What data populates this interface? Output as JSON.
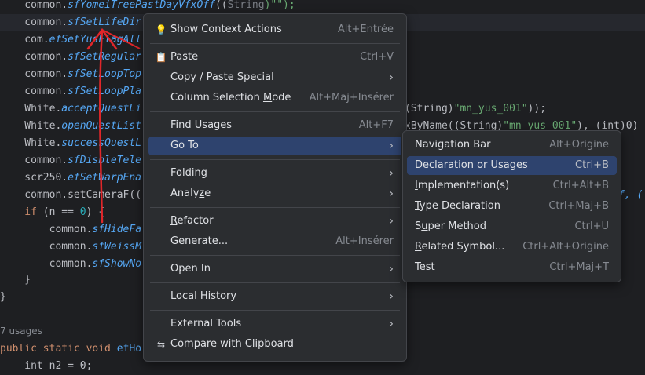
{
  "code": {
    "line0": {
      "pre": "    common.",
      "call": "sfYomeiTreePastDayVfxOff",
      "mid": "((",
      "kw": "String",
      "end": ")\"\");"
    },
    "line1": {
      "pre": "    common.",
      "call": "sfSetLifeDir"
    },
    "line2": {
      "pre": "    com.",
      "call": "efSetYusFlagAll"
    },
    "line3": {
      "pre": "    common.",
      "call": "sfSetRegular"
    },
    "line4": {
      "pre": "    common.",
      "call": "sfSetLoopTop"
    },
    "line5": {
      "pre": "    common.",
      "call": "sfSetLoopPla"
    },
    "line6": {
      "pre": "    White.",
      "call": "acceptQuestLi",
      "tail1": "(String)",
      "tail2": "\"mn_yus_001\"",
      "tail3": "));"
    },
    "line7": {
      "pre": "    White.",
      "call": "openQuestList",
      "tail1": "xByName((String)",
      "tail2": "\"mn_yus_001\"",
      "tail3": "), (int)0)"
    },
    "line8": {
      "pre": "    White.",
      "call": "successQuestL"
    },
    "line9": {
      "pre": "    common.",
      "call": "sfDisbleTele"
    },
    "line10": {
      "pre": "    scr250.",
      "call": "efSetWarpEna"
    },
    "line11": {
      "pre": "    common.",
      "call": "setCameraF",
      "open": "((",
      "tail": "f, ("
    },
    "line12": {
      "kw": "    if",
      "mid": " (n == ",
      "num": "0",
      "end": ") {"
    },
    "line13": {
      "pre": "        common.",
      "call": "sfHideFa"
    },
    "line14": {
      "pre": "        common.",
      "call": "sfWeissM"
    },
    "line15": {
      "pre": "        common.",
      "call": "sfShowNo"
    },
    "line16": {
      "text": "    }"
    },
    "line17": {
      "text": "}"
    },
    "usages": "7 usages",
    "line18": {
      "kw": "public static void ",
      "call": "efHo"
    },
    "line19": {
      "text": "    int n2 = 0;"
    }
  },
  "context_menu": {
    "show_context_actions": {
      "label": "Show Context Actions",
      "shortcut": "Alt+Entrée",
      "icon": "lightbulb-icon"
    },
    "paste": {
      "label": "Paste",
      "shortcut": "Ctrl+V",
      "icon": "clipboard-icon"
    },
    "copy_paste_special": {
      "label": "Copy / Paste Special"
    },
    "column_selection_mode": {
      "label_pre": "Column Selection ",
      "label_u": "M",
      "label_post": "ode",
      "shortcut": "Alt+Maj+Insérer"
    },
    "find_usages": {
      "label_pre": "Find ",
      "label_u": "U",
      "label_post": "sages",
      "shortcut": "Alt+F7"
    },
    "go_to": {
      "label": "Go To"
    },
    "folding": {
      "label": "Folding"
    },
    "analyze": {
      "label_pre": "Analy",
      "label_u": "z",
      "label_post": "e"
    },
    "refactor": {
      "label_pre": "",
      "label_u": "R",
      "label_post": "efactor"
    },
    "generate": {
      "label": "Generate...",
      "shortcut": "Alt+Insérer"
    },
    "open_in": {
      "label": "Open In"
    },
    "local_history": {
      "label_pre": "Local ",
      "label_u": "H",
      "label_post": "istory"
    },
    "external_tools": {
      "label": "External Tools"
    },
    "compare_clipboard": {
      "label_pre": "Compare with Clip",
      "label_u": "b",
      "label_post": "oard",
      "icon": "compare-icon"
    }
  },
  "goto_submenu": {
    "navigation_bar": {
      "label": "Navigation Bar",
      "shortcut": "Alt+Origine"
    },
    "declaration": {
      "label_pre": "",
      "label_u": "D",
      "label_post": "eclaration or Usages",
      "shortcut": "Ctrl+B"
    },
    "implementation": {
      "label_pre": "",
      "label_u": "I",
      "label_post": "mplementation(s)",
      "shortcut": "Ctrl+Alt+B"
    },
    "type_declaration": {
      "label_pre": "",
      "label_u": "T",
      "label_post": "ype Declaration",
      "shortcut": "Ctrl+Maj+B"
    },
    "super_method": {
      "label_pre": "S",
      "label_u": "u",
      "label_post": "per Method",
      "shortcut": "Ctrl+U"
    },
    "related_symbol": {
      "label_pre": "",
      "label_u": "R",
      "label_post": "elated Symbol...",
      "shortcut": "Ctrl+Alt+Origine"
    },
    "test": {
      "label_pre": "T",
      "label_u": "e",
      "label_post": "st",
      "shortcut": "Ctrl+Maj+T"
    }
  },
  "colors": {
    "selection": "#2e436e",
    "menu_bg": "#2b2d30",
    "editor_bg": "#1e1f22",
    "arrow": "#e0262a"
  }
}
